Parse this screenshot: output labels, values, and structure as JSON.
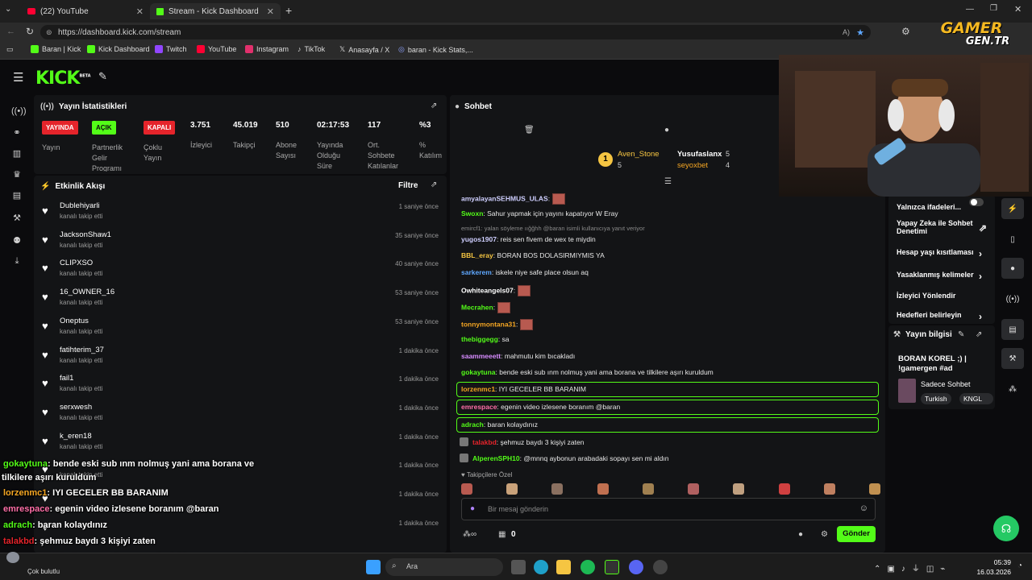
{
  "browser": {
    "tabs": [
      {
        "label": "(22) YouTube",
        "color": "#ff0033"
      },
      {
        "label": "Stream - Kick Dashboard",
        "color": "#53fc18"
      }
    ],
    "url": "https://dashboard.kick.com/stream",
    "bookmarks": [
      {
        "label": "Baran | Kick",
        "color": "#53fc18"
      },
      {
        "label": "Kick Dashboard",
        "color": "#53fc18"
      },
      {
        "label": "Twitch",
        "color": "#9146ff"
      },
      {
        "label": "YouTube",
        "color": "#ff0033"
      },
      {
        "label": "Instagram",
        "color": "#e1306c"
      },
      {
        "label": "TikTok",
        "color": "#dddddd"
      },
      {
        "label": "Anasayfa / X",
        "color": "#dddddd"
      },
      {
        "label": "baran - Kick Stats,...",
        "color": "#8fa3ff"
      }
    ]
  },
  "watermark": {
    "line1": "GAMER",
    "line2": "GEN.TR"
  },
  "kick": {
    "logo": "KICK",
    "logo_sup": "BETA",
    "stats": {
      "title": "Yayın İstatistikleri",
      "badges": [
        {
          "text": "YAYINDA",
          "label": "Yayın",
          "bg": "#e5242b",
          "fg": "#ffffff"
        },
        {
          "text": "AÇIK",
          "label": "Partnerlik Gelir Programı",
          "bg": "#53fc18",
          "fg": "#0b0b0d"
        },
        {
          "text": "KAPALI",
          "label": "Çoklu Yayın",
          "bg": "#e5242b",
          "fg": "#ffffff"
        }
      ],
      "values": [
        {
          "value": "3.751",
          "label": "İzleyici"
        },
        {
          "value": "45.019",
          "label": "Takipçi"
        },
        {
          "value": "510",
          "label": "Abone Sayısı"
        },
        {
          "value": "02:17:53",
          "label": "Yayında Olduğu Süre"
        },
        {
          "value": "117",
          "label": "Ort. Sohbete Katılanlar"
        },
        {
          "value": "%3",
          "label": "% Katılım"
        }
      ]
    },
    "events": {
      "title": "Etkinlik Akışı",
      "filter": "Filtre",
      "items": [
        {
          "name": "Dublehiyarli",
          "sub": "kanalı takip etti",
          "time": "1 saniye önce"
        },
        {
          "name": "JacksonShaw1",
          "sub": "kanalı takip etti",
          "time": "35 saniye önce"
        },
        {
          "name": "CLIPXSO",
          "sub": "kanalı takip etti",
          "time": "40 saniye önce"
        },
        {
          "name": "16_OWNER_16",
          "sub": "kanalı takip etti",
          "time": "53 saniye önce"
        },
        {
          "name": "Oneptus",
          "sub": "kanalı takip etti",
          "time": "53 saniye önce"
        },
        {
          "name": "fatihterim_37",
          "sub": "kanalı takip etti",
          "time": "1 dakika önce"
        },
        {
          "name": "fail1",
          "sub": "kanalı takip etti",
          "time": "1 dakika önce"
        },
        {
          "name": "serxwesh",
          "sub": "kanalı takip etti",
          "time": "1 dakika önce"
        },
        {
          "name": "k_eren18",
          "sub": "kanalı takip etti",
          "time": "1 dakika önce"
        },
        {
          "name": "",
          "sub": "kanalı takip etti",
          "time": "1 dakika önce"
        },
        {
          "name": "",
          "sub": "",
          "time": "1 dakika önce"
        },
        {
          "name": "",
          "sub": "",
          "time": "1 dakika önce"
        }
      ]
    },
    "chat": {
      "title": "Sohbet",
      "top_users": [
        {
          "name": "Aven_Stone",
          "count": "5",
          "color": "#f5c542"
        },
        {
          "name": "Yusufaslanx",
          "count": "5",
          "color": "#ffffff"
        },
        {
          "name": "seyoxbet",
          "count": "4",
          "color": "#f5a623"
        }
      ],
      "reply_note": "emircf1: yalan söyleme ıığğhh @baran isimli kullanıcıya yanıt veriyor",
      "messages": [
        {
          "user": "amyalayanSEHMUS_ULAS",
          "text": "",
          "color": "#cfcfff",
          "emote": true
        },
        {
          "user": "Swoxn",
          "text": ": Sahur yapmak için yayını kapatıyor W Eray",
          "color": "#53fc18",
          "emote": false
        },
        {
          "user": "yugos1907",
          "text": ": reis sen fivem de wex te miydin",
          "color": "#cfcfff",
          "emote": false
        },
        {
          "user": "BBL_eray",
          "text": ": BORAN BOS DOLASIRMIYMIS YA",
          "color": "#f5c542",
          "emote": false
        },
        {
          "user": "sarkerem",
          "text": ": iskele niye safe place olsun aq",
          "color": "#5fa8ff",
          "emote": false
        },
        {
          "user": "Owhiteangels07",
          "text": "",
          "color": "#ffffff",
          "emote": true
        },
        {
          "user": "Mecrahen",
          "text": "",
          "color": "#53fc18",
          "emote": true
        },
        {
          "user": "tonnymontana31",
          "text": "",
          "color": "#f5a623",
          "emote": true
        },
        {
          "user": "thebiggegg",
          "text": ": sa",
          "color": "#53fc18",
          "emote": false
        },
        {
          "user": "saammeeett",
          "text": ": mahmutu kim bıcakladı",
          "color": "#d78cff",
          "emote": false
        },
        {
          "user": "gokaytuna",
          "text": ": bende eski sub ınm nolmuş yani ama borana ve tilkilere aşırı kuruldum",
          "color": "#53fc18",
          "emote": false
        },
        {
          "user": "lorzenmc1",
          "text": ": IYI GECELER BB BARANIM",
          "color": "#f5a623",
          "emote": false
        },
        {
          "user": "emrespace",
          "text": ": egenin video izlesene boranım @baran",
          "color": "#ff6fa8",
          "emote": false
        },
        {
          "user": "adrach",
          "text": ": baran kolaydınız",
          "color": "#53fc18",
          "emote": false
        },
        {
          "user": "talakbd",
          "text": ": şehmuz baydı 3 kişiyi zaten",
          "color": "#e5242b",
          "emote": false
        },
        {
          "user": "AlperenSPH10",
          "text": ": @mnnq aybonun arabadaki sopayı sen mi aldın",
          "color": "#53fc18",
          "emote": false
        }
      ],
      "followers_only": "Takipçilere Özel",
      "input_placeholder": "Bir mesaj gönderin",
      "points": "0",
      "send_label": "Gönder"
    },
    "side": {
      "menu": [
        {
          "label": "Yalnızca ifadeleri..."
        },
        {
          "label": "Yapay Zeka ile Sohbet Denetimi"
        },
        {
          "label": "Hesap yaşı kısıtlaması"
        },
        {
          "label": "Yasaklanmış kelimeler"
        },
        {
          "label": "İzleyici Yönlendir"
        },
        {
          "label": "Hedefleri belirleyin"
        }
      ],
      "info_title": "Yayın bilgisi",
      "stream_title": "BORAN KOREL ;) | !gamergen #ad",
      "category": "Sadece Sohbet",
      "tags": [
        "Turkish",
        "KNGL"
      ]
    }
  },
  "overlay_chat": [
    {
      "user": "gokaytuna",
      "text": ": bende eski sub ınm nolmuş yani ama borana ve",
      "color": "#53fc18"
    },
    {
      "user": "",
      "text": "tilkilere aşırı kuruldum",
      "color": "#ffffff"
    },
    {
      "user": "lorzenmc1",
      "text": ": IYI GECELER BB BARANIM",
      "color": "#f5a623"
    },
    {
      "user": "emrespace",
      "text": ": egenin video izlesene boranım @baran",
      "color": "#ff6fa8"
    },
    {
      "user": "adrach",
      "text": ": baran kolaydınız",
      "color": "#53fc18"
    },
    {
      "user": "talakbd",
      "text": ": şehmuz baydı 3 kişiyi zaten",
      "color": "#e5242b"
    },
    {
      "user": "AlperenSPH10",
      "text": ": @mnnq aybonun arabadaki sopayı sen mi",
      "color": "#53fc18"
    },
    {
      "user": "",
      "text": "aldın",
      "color": "#ffffff"
    }
  ],
  "taskbar": {
    "weather": "Çok bulutlu",
    "search": "Ara",
    "time": "05:39",
    "date": "16.03.2026"
  }
}
